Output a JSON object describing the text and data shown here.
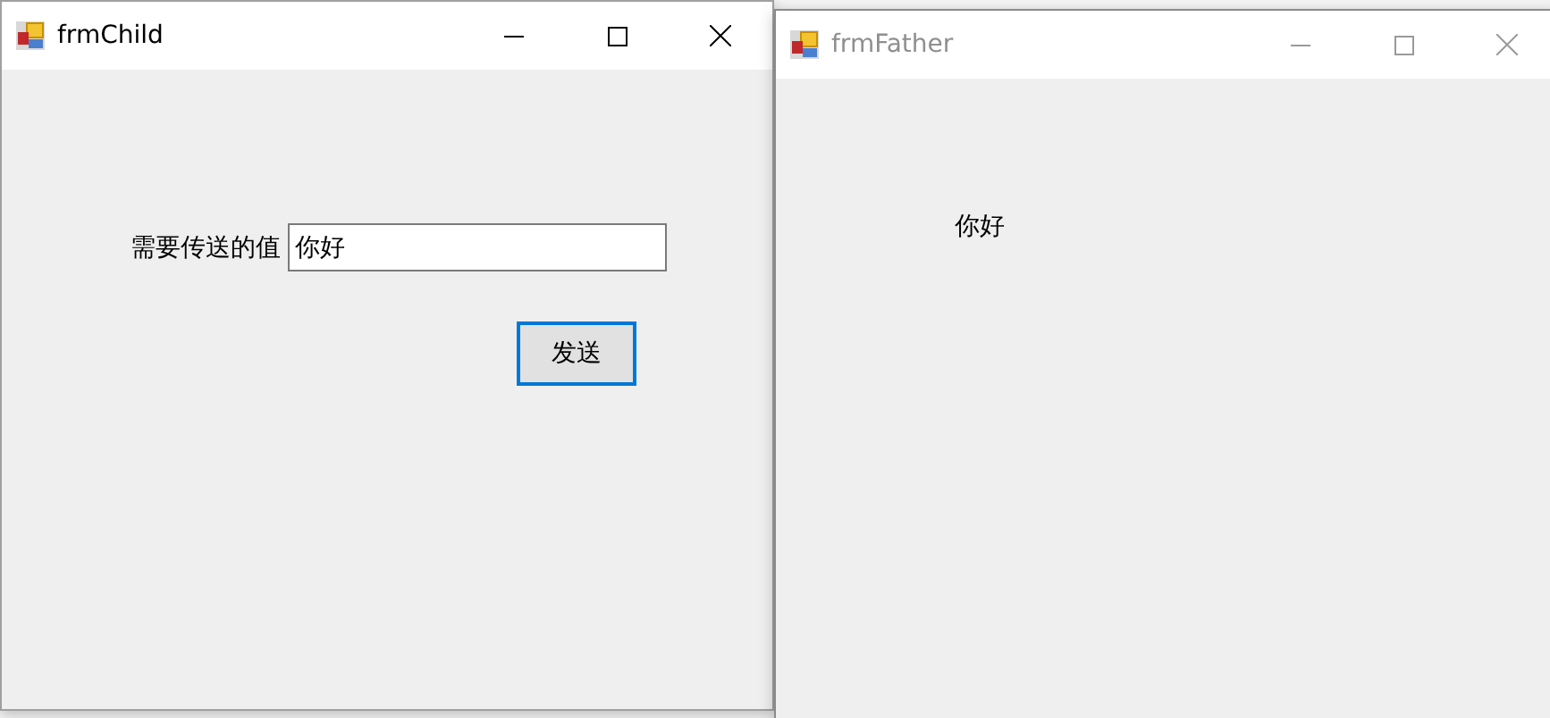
{
  "windows": [
    {
      "title": "frmChild",
      "active": true,
      "kind": "sender",
      "label": "需要传送的值",
      "value": "你好",
      "button": "发送"
    },
    {
      "title": "frmFather",
      "active": false,
      "kind": "receiver",
      "text": "你好"
    }
  ]
}
